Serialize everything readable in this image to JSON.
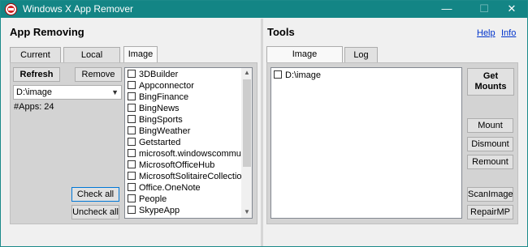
{
  "window": {
    "title": "Windows X App Remover",
    "controls": {
      "minimize": "—",
      "maximize": "☐",
      "close": "✕"
    }
  },
  "left": {
    "title": "App Removing",
    "tabs": [
      "Current User",
      "Local Machine",
      "Image"
    ],
    "active_tab": "Image",
    "refresh_label": "Refresh",
    "remove_label": "Remove",
    "image_select_value": "D:\\image",
    "apps_count": "#Apps: 24",
    "check_all_label": "Check all",
    "uncheck_all_label": "Uncheck all",
    "apps": [
      "3DBuilder",
      "Appconnector",
      "BingFinance",
      "BingNews",
      "BingSports",
      "BingWeather",
      "Getstarted",
      "microsoft.windowscommunic",
      "MicrosoftOfficeHub",
      "MicrosoftSolitaireCollection",
      "Office.OneNote",
      "People",
      "SkypeApp"
    ]
  },
  "right": {
    "title": "Tools",
    "help_label": "Help",
    "info_label": "Info",
    "tabs": [
      "Image Management",
      "Log"
    ],
    "active_tab": "Image Management",
    "images": [
      "D:\\image"
    ],
    "get_mounts_label": "Get\nMounts",
    "get_mounts_line1": "Get",
    "get_mounts_line2": "Mounts",
    "mount_label": "Mount",
    "dismount_label": "Dismount",
    "remount_label": "Remount",
    "scanimage_label": "ScanImage",
    "repairmp_label": "RepairMP"
  },
  "colors": {
    "titlebar": "#138585",
    "accent": "#0078d7"
  }
}
